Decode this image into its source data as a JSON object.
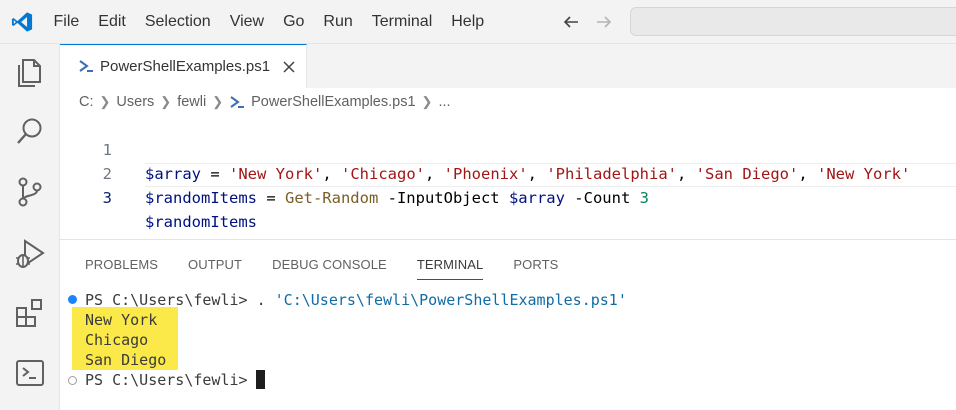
{
  "menubar": {
    "items": [
      "File",
      "Edit",
      "Selection",
      "View",
      "Go",
      "Run",
      "Terminal",
      "Help"
    ]
  },
  "activitybar": {
    "icons": [
      "explorer-icon",
      "search-icon",
      "source-control-icon",
      "run-debug-icon",
      "extensions-icon",
      "terminal-icon"
    ]
  },
  "editor": {
    "tab": {
      "title": "PowerShellExamples.ps1"
    },
    "breadcrumb": [
      "C:",
      "Users",
      "fewli",
      "PowerShellExamples.ps1",
      "..."
    ],
    "lines": [
      {
        "number": "1",
        "tokens": [
          {
            "t": "$array",
            "k": "var"
          },
          {
            "t": " = ",
            "k": "op"
          },
          {
            "t": "'New York'",
            "k": "str"
          },
          {
            "t": ", ",
            "k": "op"
          },
          {
            "t": "'Chicago'",
            "k": "str"
          },
          {
            "t": ", ",
            "k": "op"
          },
          {
            "t": "'Phoenix'",
            "k": "str"
          },
          {
            "t": ", ",
            "k": "op"
          },
          {
            "t": "'Philadelphia'",
            "k": "str"
          },
          {
            "t": ", ",
            "k": "op"
          },
          {
            "t": "'San Diego'",
            "k": "str"
          },
          {
            "t": ", ",
            "k": "op"
          },
          {
            "t": "'New York'",
            "k": "str"
          }
        ]
      },
      {
        "number": "2",
        "tokens": [
          {
            "t": "$randomItems",
            "k": "var"
          },
          {
            "t": " = ",
            "k": "op"
          },
          {
            "t": "Get-Random",
            "k": "cmd"
          },
          {
            "t": " -InputObject ",
            "k": "param"
          },
          {
            "t": "$array",
            "k": "var"
          },
          {
            "t": " -Count ",
            "k": "param"
          },
          {
            "t": "3",
            "k": "num"
          }
        ]
      },
      {
        "number": "3",
        "tokens": [
          {
            "t": "$randomItems",
            "k": "var"
          }
        ]
      }
    ]
  },
  "panel": {
    "tabs": [
      "PROBLEMS",
      "OUTPUT",
      "DEBUG CONSOLE",
      "TERMINAL",
      "PORTS"
    ],
    "active_tab": "TERMINAL"
  },
  "terminal": {
    "prompt": "PS C:\\Users\\fewli> ",
    "command_dot": ". ",
    "command_path": "'C:\\Users\\fewli\\PowerShellExamples.ps1'",
    "output": [
      "New York",
      "Chicago",
      "San Diego"
    ],
    "final_prompt": "PS C:\\Users\\fewli> "
  },
  "colors": {
    "accent": "#0078d4",
    "highlight": "#fbe94a",
    "string": "#a31515",
    "variable": "#001080"
  }
}
